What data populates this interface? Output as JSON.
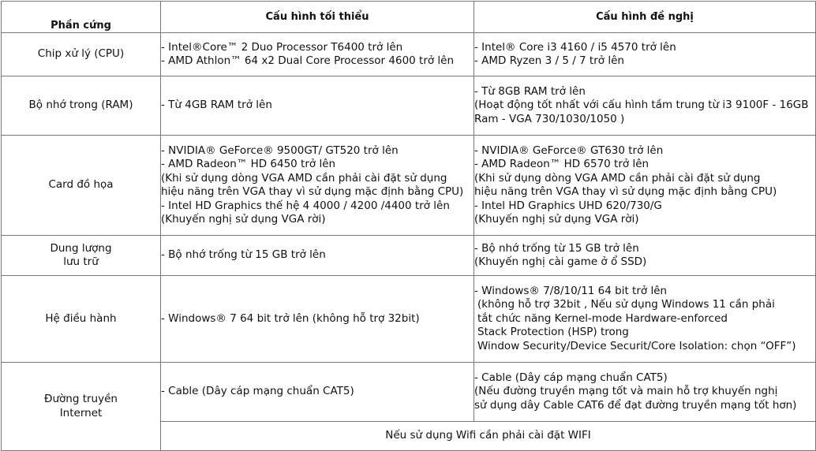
{
  "headers": {
    "component": "Phần cứng",
    "minimum": "Cấu hình tối thiểu",
    "recommended": "Cấu hình đề nghị"
  },
  "rows": [
    {
      "label": "Chip xử lý (CPU)",
      "minimum": [
        "- Intel®Core™ 2 Duo Processor T6400 trở lên",
        "- AMD Athlon™ 64 x2 Dual Core Processor 4600 trở lên"
      ],
      "recommended": [
        "- Intel® Core i3 4160 / i5 4570 trở lên",
        "- AMD Ryzen 3 / 5 / 7 trở lên"
      ]
    },
    {
      "label": "Bộ nhớ trong (RAM)",
      "minimum": [
        "- Từ 4GB RAM trở lên"
      ],
      "recommended": [
        "- Từ 8GB RAM trở lên",
        "(Hoạt động tốt nhất với cấu hình tầm trung từ i3 9100F - 16GB",
        "Ram - VGA 730/1030/1050 )"
      ]
    },
    {
      "label": "Card đồ họa",
      "minimum": [
        "- NVIDIA® GeForce® 9500GT/ GT520 trở lên",
        "- AMD Radeon™ HD 6450 trở lên",
        "(Khi sử dụng dòng VGA AMD cần phải cài đặt sử dụng",
        "hiệu năng trên VGA thay vì sử dụng mặc định bằng CPU)",
        "- Intel HD Graphics thế hệ 4 4000 / 4200 /4400 trở lên",
        "(Khuyến nghị sử dụng VGA rời)"
      ],
      "recommended": [
        "- NVIDIA® GeForce® GT630 trở lên",
        "- AMD Radeon™ HD 6570 trở lên",
        "(Khi sử dụng dòng VGA AMD cần phải cài đặt sử dụng",
        "hiệu năng trên VGA thay vì sử dụng mặc định bằng CPU)",
        "- Intel HD Graphics UHD 620/730/G",
        "(Khuyến nghị sử dụng VGA rời)"
      ]
    },
    {
      "label_lines": [
        "Dung lượng",
        "lưu trữ"
      ],
      "minimum": [
        "- Bộ nhớ trống từ 15 GB trở lên"
      ],
      "recommended": [
        "- Bộ nhớ trống từ 15 GB trở lên",
        "(Khuyến nghị cài game ở ổ SSD)"
      ]
    },
    {
      "label": "Hệ điều hành",
      "minimum": [
        "- Windows® 7 64 bit trở lên (không hỗ trợ 32bit)"
      ],
      "recommended": [
        "- Windows® 7/8/10/11 64 bit trở lên",
        "(không hỗ trợ 32bit , Nếu sử dụng Windows 11 cần phải",
        "tắt chức năng Kernel-mode Hardware-enforced",
        "Stack Protection (HSP) trong",
        "Window Security/Device Securit/Core Isolation: chọn “OFF”)"
      ]
    },
    {
      "label_lines": [
        "Đường truyền",
        "Internet"
      ],
      "minimum": [
        "- Cable (Dây cáp mạng chuẩn CAT5)"
      ],
      "recommended": [
        "- Cable (Dây cáp mạng chuẩn CAT5)",
        "(Nếu đường truyền mạng tốt và main hỗ trợ khuyến nghị",
        "sử dụng dây Cable CAT6 để đạt đường truyền mạng tốt hơn)"
      ]
    }
  ],
  "wifi_note": "Nếu sử dụng Wifi cần phải cài đặt WIFI"
}
